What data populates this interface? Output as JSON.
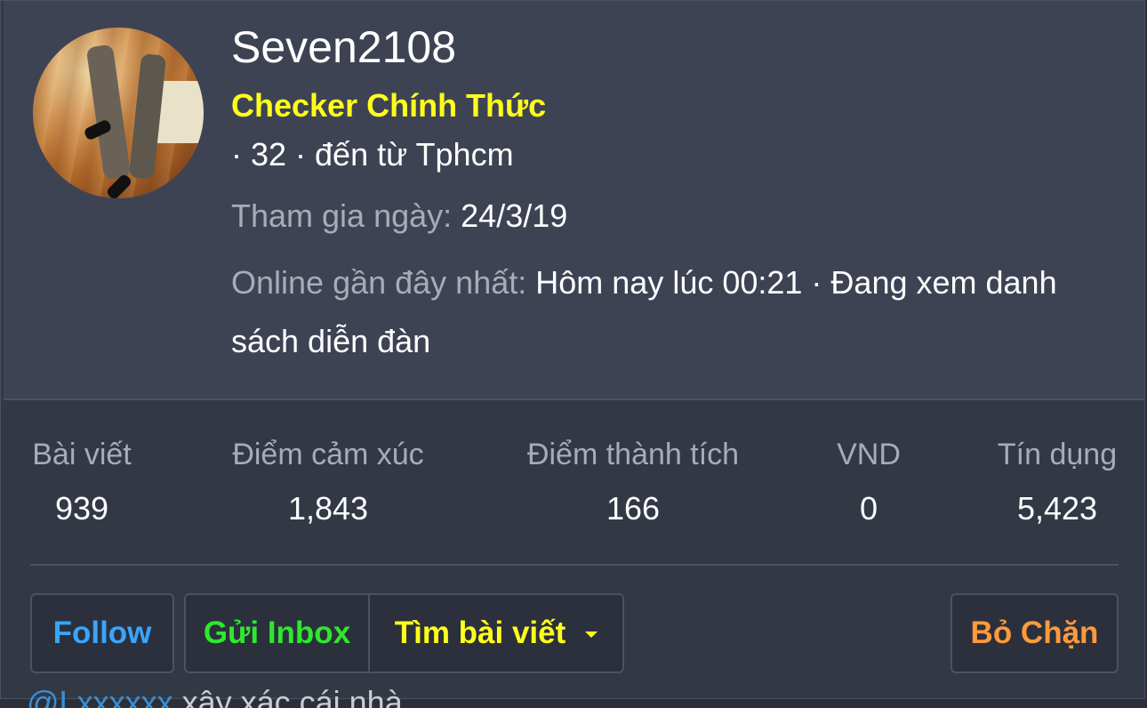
{
  "profile": {
    "username": "Seven2108",
    "title": "Checker Chính Thức",
    "blurb": "· 32 · đến từ Tphcm",
    "joined_label": "Tham gia ngày:",
    "joined_value": "24/3/19",
    "online_label": "Online gần đây nhất:",
    "online_value": "Hôm nay lúc 00:21 · Đang xem danh sách diễn đàn"
  },
  "stats": [
    {
      "label": "Bài viết",
      "value": "939"
    },
    {
      "label": "Điểm cảm xúc",
      "value": "1,843"
    },
    {
      "label": "Điểm thành tích",
      "value": "166"
    },
    {
      "label": "VND",
      "value": "0"
    },
    {
      "label": "Tín dụng",
      "value": "5,423"
    }
  ],
  "actions": {
    "follow": "Follow",
    "inbox": "Gửi Inbox",
    "find_posts": "Tìm bài viết",
    "unblock": "Bỏ Chặn"
  },
  "colors": {
    "title_yellow": "#ffff1a",
    "follow_blue": "#3aa4ff",
    "inbox_green": "#2ee82e",
    "unblock_orange": "#ff9a3c"
  },
  "icons": {
    "find_posts_dropdown": "caret-down-icon"
  },
  "peek": {
    "link": "@Lxxxxxx",
    "text": "xây xác cái nhà"
  }
}
